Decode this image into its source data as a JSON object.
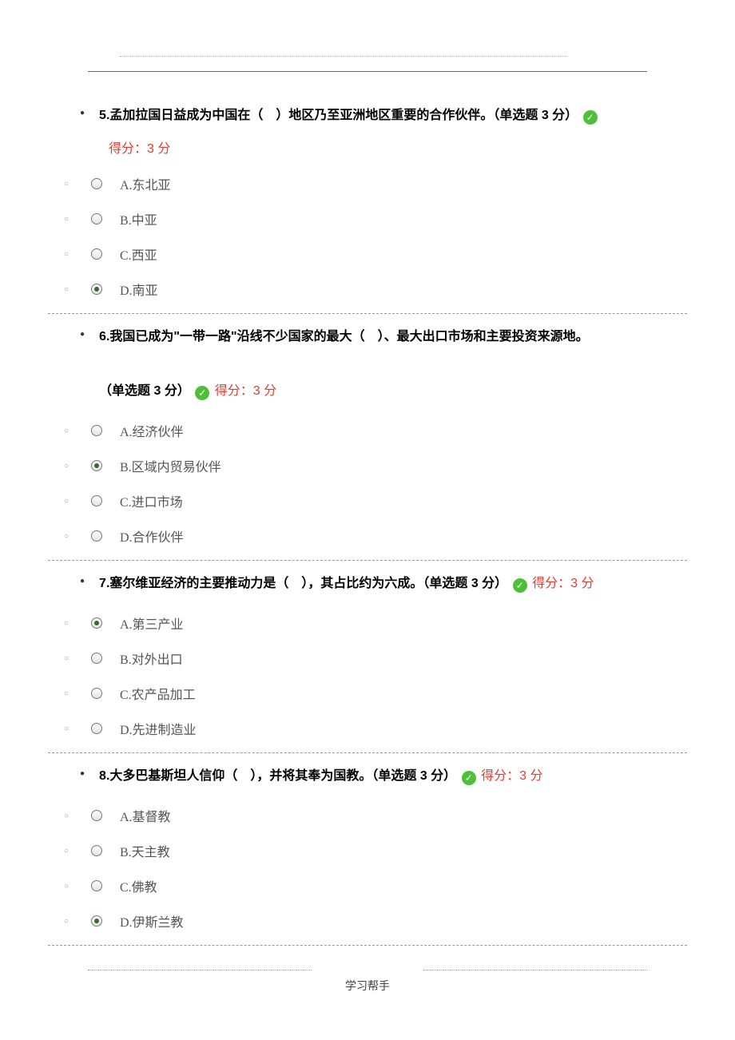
{
  "footer": "学习帮手",
  "score_prefix": "得分：3 分",
  "questions": [
    {
      "id": "q5",
      "text": "5.孟加拉国日益成为中国在（　）地区乃至亚洲地区重要的合作伙伴。（单选题 3 分）",
      "score_inline": false,
      "options": [
        {
          "label": "A.东北亚",
          "selected": false
        },
        {
          "label": "B.中亚",
          "selected": false
        },
        {
          "label": "C.西亚",
          "selected": false
        },
        {
          "label": "D.南亚",
          "selected": true
        }
      ]
    },
    {
      "id": "q6",
      "text_a": "6.我国已成为\"一带一路\"沿线不少国家的最大（　）、最大出口市场和主要投资来源地。",
      "text_b": "（单选题 3 分）",
      "score_inline": true,
      "options": [
        {
          "label": "A.经济伙伴",
          "selected": false
        },
        {
          "label": "B.区域内贸易伙伴",
          "selected": true
        },
        {
          "label": "C.进口市场",
          "selected": false
        },
        {
          "label": "D.合作伙伴",
          "selected": false
        }
      ]
    },
    {
      "id": "q7",
      "text": "7.塞尔维亚经济的主要推动力是（　），其占比约为六成。（单选题 3 分）",
      "score_inline": true,
      "options": [
        {
          "label": "A.第三产业",
          "selected": true
        },
        {
          "label": "B.对外出口",
          "selected": false
        },
        {
          "label": "C.农产品加工",
          "selected": false
        },
        {
          "label": "D.先进制造业",
          "selected": false
        }
      ]
    },
    {
      "id": "q8",
      "text": "8.大多巴基斯坦人信仰（　），并将其奉为国教。（单选题 3 分）",
      "score_inline": true,
      "options": [
        {
          "label": "A.基督教",
          "selected": false
        },
        {
          "label": "B.天主教",
          "selected": false
        },
        {
          "label": "C.佛教",
          "selected": false
        },
        {
          "label": "D.伊斯兰教",
          "selected": true
        }
      ]
    }
  ]
}
